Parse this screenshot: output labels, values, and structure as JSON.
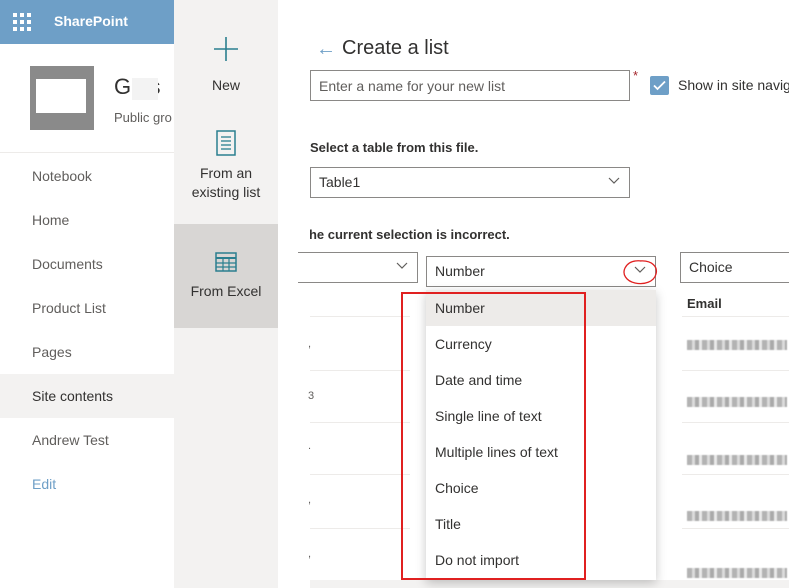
{
  "suite_bar": {
    "brand": "SharePoint"
  },
  "site": {
    "name": "Ga s",
    "subtitle": "Public gro"
  },
  "nav": {
    "items": [
      {
        "label": "Notebook"
      },
      {
        "label": "Home"
      },
      {
        "label": "Documents"
      },
      {
        "label": "Product List"
      },
      {
        "label": "Pages"
      },
      {
        "label": "Site contents"
      },
      {
        "label": "Andrew Test"
      },
      {
        "label": "Edit"
      }
    ],
    "selected": "Site contents"
  },
  "options": {
    "new": "New",
    "existing_line1": "From an",
    "existing_line2": "existing list",
    "excel": "From Excel",
    "selected": "From Excel"
  },
  "panel": {
    "title": "Create a list",
    "name_placeholder": "Enter a name for your new list",
    "required_marker": "*",
    "show_in_nav_label": "Show in site navig",
    "show_in_nav_checked": true,
    "table_label": "Select a table from this file.",
    "table_value": "Table1",
    "warning": "The current selection is incorrect.",
    "column_type_value": "Number",
    "next_column_value": "Choice",
    "email_header": "Email",
    "row_marks": [
      ",",
      "3",
      ".",
      ",",
      ",",
      "."
    ]
  },
  "dropdown": {
    "options": [
      "Number",
      "Currency",
      "Date and time",
      "Single line of text",
      "Multiple lines of text",
      "Choice",
      "Title",
      "Do not import"
    ],
    "selected": "Number"
  },
  "colors": {
    "accent": "#6e9fc7",
    "annotation": "#e02020",
    "required": "#a4262c"
  },
  "icons": [
    "waffle-icon",
    "plus-icon",
    "list-document-icon",
    "table-grid-icon",
    "back-arrow-icon",
    "chevron-down-icon",
    "checkmark-icon"
  ]
}
